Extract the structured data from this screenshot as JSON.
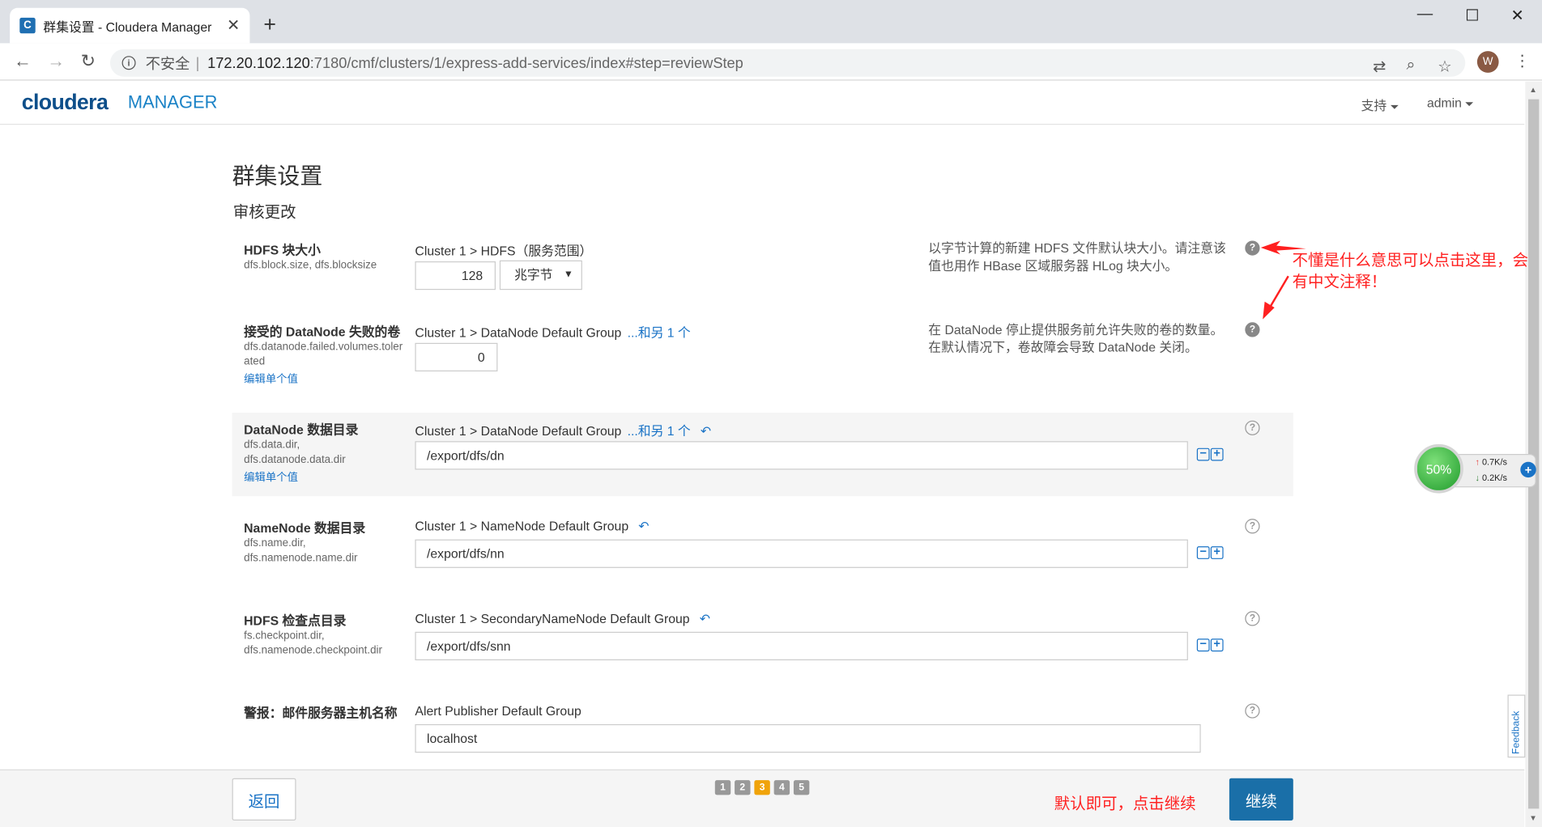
{
  "browser": {
    "tab_title": "群集设置 - Cloudera Manager",
    "tab_favicon": "C",
    "insecure_label": "不安全",
    "url_host": "172.20.102.120",
    "url_rest": ":7180/cmf/clusters/1/express-add-services/index#step=reviewStep",
    "avatar_letter": "W"
  },
  "header": {
    "logo": "cloudera",
    "logo_manager": "MANAGER",
    "support": "支持",
    "admin": "admin"
  },
  "page": {
    "title": "群集设置",
    "subtitle": "审核更改"
  },
  "properties": [
    {
      "name": "HDFS 块大小",
      "keys": "dfs.block.size, dfs.blocksize",
      "scope": "Cluster 1 > HDFS（服务范围）",
      "value": "128",
      "unit": "兆字节",
      "description": "以字节计算的新建 HDFS 文件默认块大小。请注意该值也用作 HBase 区域服务器 HLog 块大小。"
    },
    {
      "name": "接受的 DataNode 失败的卷",
      "keys": "dfs.datanode.failed.volumes.tolerated",
      "edit": "编辑单个值",
      "scope": "Cluster 1 > DataNode Default Group",
      "more": "...和另 1 个",
      "value": "0",
      "description": "在 DataNode 停止提供服务前允许失败的卷的数量。在默认情况下，卷故障会导致 DataNode 关闭。"
    },
    {
      "name": "DataNode 数据目录",
      "keys": "dfs.data.dir, dfs.datanode.data.dir",
      "edit": "编辑单个值",
      "scope": "Cluster 1 > DataNode Default Group",
      "more": "...和另 1 个",
      "value": "/export/dfs/dn"
    },
    {
      "name": "NameNode 数据目录",
      "keys": "dfs.name.dir, dfs.namenode.name.dir",
      "scope": "Cluster 1 > NameNode Default Group",
      "value": "/export/dfs/nn"
    },
    {
      "name": "HDFS 检查点目录",
      "keys": "fs.checkpoint.dir, dfs.namenode.checkpoint.dir",
      "scope": "Cluster 1 > SecondaryNameNode Default Group",
      "value": "/export/dfs/snn"
    },
    {
      "name": "警报：邮件服务器主机名称",
      "scope": "Alert Publisher Default Group",
      "value": "localhost"
    }
  ],
  "annotations": {
    "help_note": "不懂是什么意思可以点击这里，会有中文注释！",
    "continue_note": "默认即可，点击继续"
  },
  "speed_widget": {
    "percent": "50%",
    "up": "0.7K/s",
    "down": "0.2K/s"
  },
  "feedback": "Feedback",
  "footer": {
    "back": "返回",
    "steps": [
      "1",
      "2",
      "3",
      "4",
      "5"
    ],
    "active_step": 3,
    "continue": "继续"
  },
  "colors": {
    "brand": "#0e4f8a",
    "link": "#1a73c6",
    "primary_button": "#1a6fa8",
    "active_step": "#f0a30a",
    "annotation": "#ff2020"
  }
}
